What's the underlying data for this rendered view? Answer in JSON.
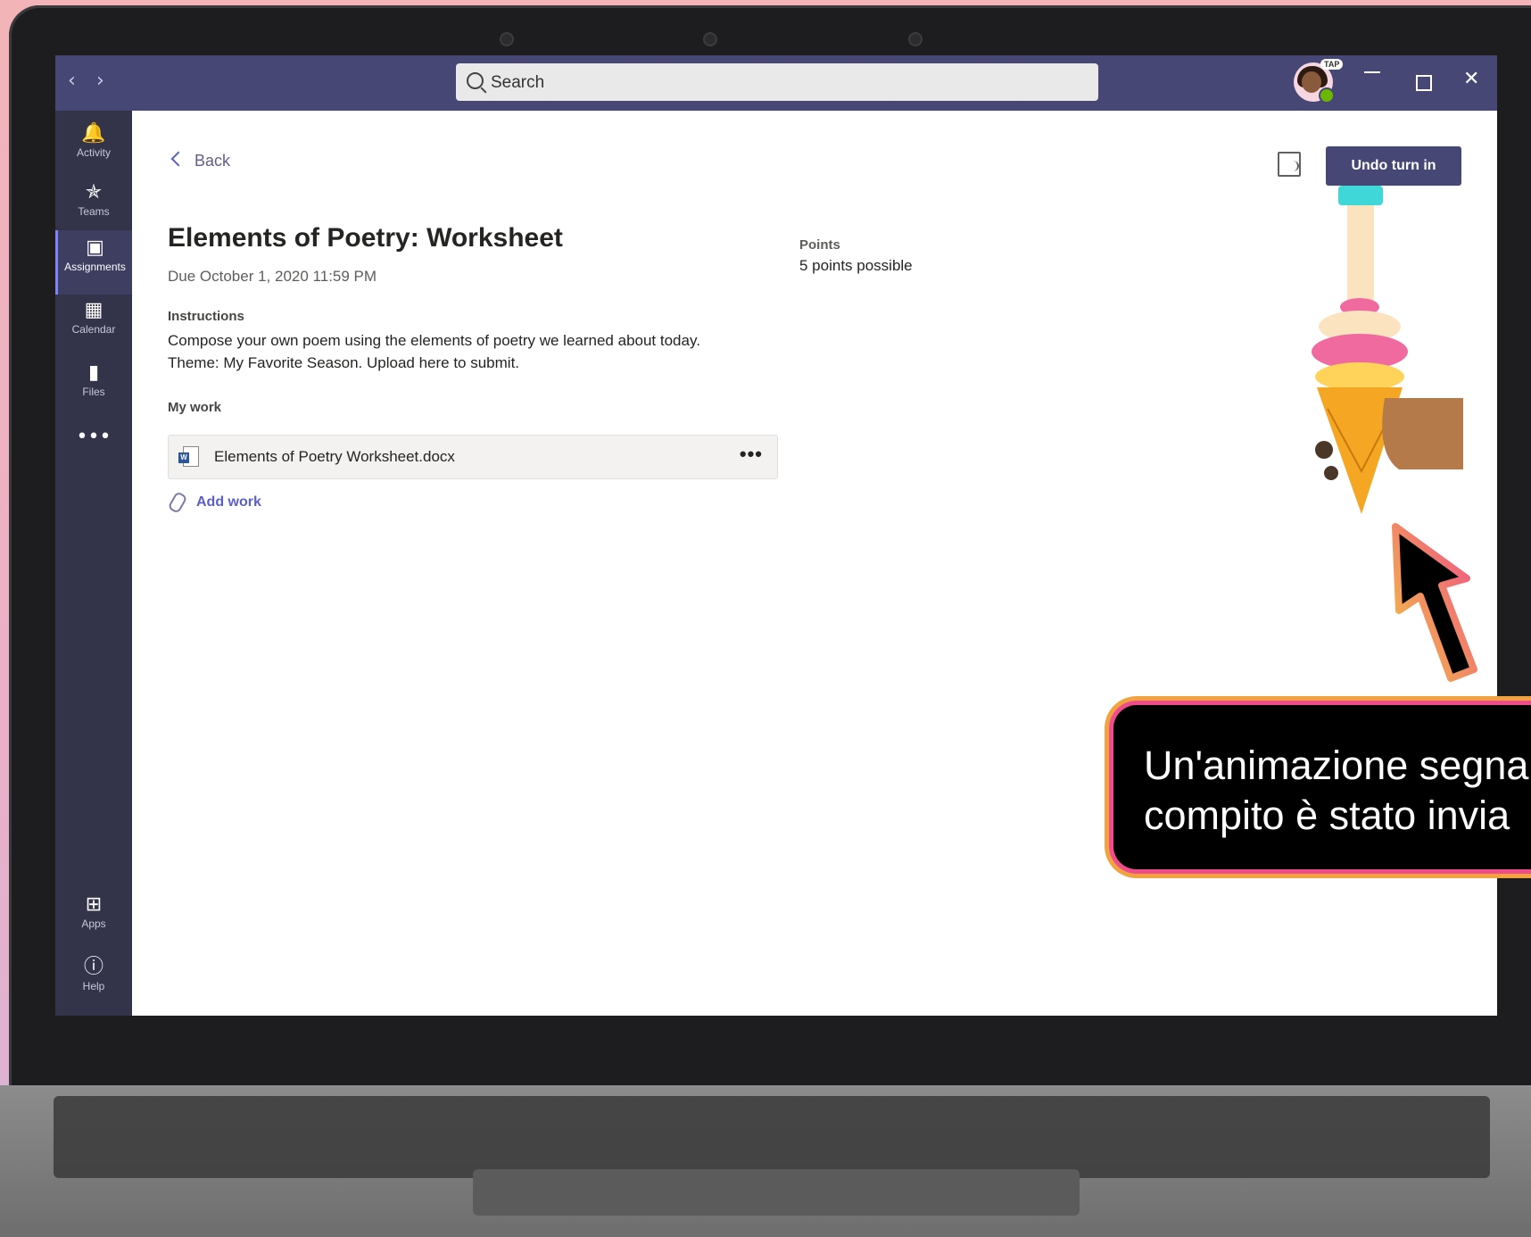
{
  "search": {
    "placeholder": "Search"
  },
  "profile": {
    "badge": "TAP"
  },
  "rail": {
    "items": [
      {
        "label": "Activity",
        "icon": "bell-icon"
      },
      {
        "label": "Teams",
        "icon": "teams-icon"
      },
      {
        "label": "Assignments",
        "icon": "assignments-icon",
        "active": true
      },
      {
        "label": "Calendar",
        "icon": "calendar-icon"
      },
      {
        "label": "Files",
        "icon": "files-icon"
      }
    ],
    "more": "•••",
    "bottom": [
      {
        "label": "Apps",
        "icon": "apps-icon"
      },
      {
        "label": "Help",
        "icon": "help-icon"
      }
    ]
  },
  "assignment": {
    "back_label": "Back",
    "title": "Elements of Poetry: Worksheet",
    "due": "Due October 1, 2020 11:59 PM",
    "instructions_label": "Instructions",
    "instructions_line1": "Compose your own poem using the elements of poetry we learned about today.",
    "instructions_line2": "Theme: My Favorite Season. Upload here to submit.",
    "my_work_label": "My work",
    "file_name": "Elements of Poetry Worksheet.docx",
    "more_label": "•••",
    "add_work_label": "Add work",
    "points_label": "Points",
    "points_value": "5 points possible"
  },
  "toolbar": {
    "undo_label": "Undo turn in"
  },
  "callout": {
    "line1": "Un'animazione segna",
    "line2": "compito è stato invia"
  },
  "colors": {
    "titlebar": "#464775",
    "accent": "#5b5fc7",
    "callout_border_pink": "#ee4c8a",
    "callout_border_orange": "#f2a340"
  }
}
